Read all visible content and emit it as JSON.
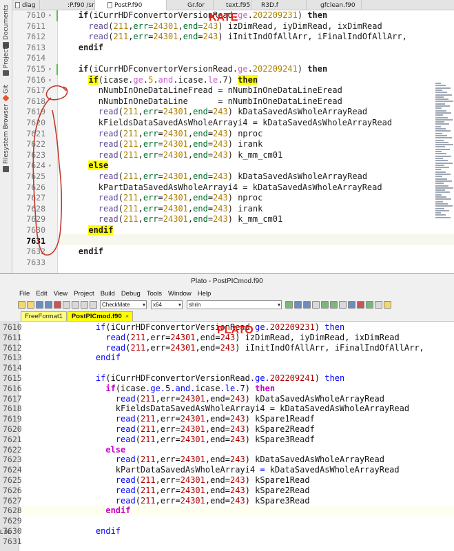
{
  "kate": {
    "annotation": "KATE",
    "side_panels": [
      "Documents",
      "Projects",
      "Git",
      "Filesystem Browser"
    ],
    "tabs": [
      "diag",
      ":P.f90 /src/io",
      "PostP.f90",
      "Gr.for",
      "text.f95",
      "R3D.f",
      "gfclean.f90"
    ],
    "active_tab": 2,
    "lines": [
      {
        "n": "7610",
        "fold": "▾",
        "code": "    if(iCurrHDFconvertorVersionRead.ge.202209231) then"
      },
      {
        "n": "7611",
        "fold": "",
        "code": "      read(211,err=24301,end=243) izDimRead, iyDimRead, ixDimRead"
      },
      {
        "n": "7612",
        "fold": "",
        "code": "      read(211,err=24301,end=243) iInitIndOfAllArr, iFinalIndOfAllArr,"
      },
      {
        "n": "7613",
        "fold": "",
        "code": "    endif"
      },
      {
        "n": "7614",
        "fold": "",
        "code": ""
      },
      {
        "n": "7615",
        "fold": "▾",
        "code": "    if(iCurrHDFconvertorVersionRead.ge.202209241) then"
      },
      {
        "n": "7616",
        "fold": "▾",
        "code": "      if(icase.ge.5.and.icase.le.7) then"
      },
      {
        "n": "7617",
        "fold": "",
        "code": "        nNumbInOneDataLineFread = nNumbInOneDataLineEread"
      },
      {
        "n": "7618",
        "fold": "",
        "code": "        nNumbInOneDataLine      = nNumbInOneDataLineEread"
      },
      {
        "n": "7619",
        "fold": "",
        "code": "        read(211,err=24301,end=243) kDataSavedAsWholeArrayRead"
      },
      {
        "n": "7620",
        "fold": "",
        "code": "        kFieldsDataSavedAsWholeArrayi4 = kDataSavedAsWholeArrayRead"
      },
      {
        "n": "7621",
        "fold": "",
        "code": "        read(211,err=24301,end=243) nproc"
      },
      {
        "n": "7622",
        "fold": "",
        "code": "        read(211,err=24301,end=243) irank"
      },
      {
        "n": "7623",
        "fold": "",
        "code": "        read(211,err=24301,end=243) k_mm_cm01"
      },
      {
        "n": "7624",
        "fold": "▾",
        "code": "      else"
      },
      {
        "n": "7625",
        "fold": "",
        "code": "        read(211,err=24301,end=243) kDataSavedAsWholeArrayRead"
      },
      {
        "n": "7626",
        "fold": "",
        "code": "        kPartDataSavedAsWholeArrayi4 = kDataSavedAsWholeArrayRead"
      },
      {
        "n": "7627",
        "fold": "",
        "code": "        read(211,err=24301,end=243) nproc"
      },
      {
        "n": "7628",
        "fold": "",
        "code": "        read(211,err=24301,end=243) irank"
      },
      {
        "n": "7629",
        "fold": "",
        "code": "        read(211,err=24301,end=243) k_mm_cm01"
      },
      {
        "n": "7630",
        "fold": "",
        "code": "      endif"
      },
      {
        "n": "7631",
        "fold": "",
        "code": ""
      },
      {
        "n": "7632",
        "fold": "",
        "code": "    endif"
      },
      {
        "n": "7633",
        "fold": "",
        "code": ""
      }
    ],
    "current_line": "7631"
  },
  "plato": {
    "window_title": "Plato - PostPICmod.f90",
    "annotation": "PLATO",
    "menu": [
      "File",
      "Edit",
      "View",
      "Project",
      "Build",
      "Debug",
      "Tools",
      "Window",
      "Help"
    ],
    "toolbar": {
      "config": "CheckMate",
      "platform": "x64",
      "search": "shrin"
    },
    "tabs": [
      "FreeFormat1",
      "PostPICmod.f90"
    ],
    "tab_close": "×",
    "left_label": "L  90",
    "lines": [
      {
        "n": "7610",
        "code": "    if(iCurrHDFconvertorVersionRead.ge.202209231) then"
      },
      {
        "n": "7611",
        "code": "      read(211,err=24301,end=243) izDimRead, iyDimRead, ixDimRead"
      },
      {
        "n": "7612",
        "code": "      read(211,err=24301,end=243) iInitIndOfAllArr, iFinalIndOfAllArr,"
      },
      {
        "n": "7613",
        "code": "    endif"
      },
      {
        "n": "7614",
        "code": ""
      },
      {
        "n": "7615",
        "code": "    if(iCurrHDFconvertorVersionRead.ge.202209241) then"
      },
      {
        "n": "7616",
        "code": "      if(icase.ge.5.and.icase.le.7) then"
      },
      {
        "n": "7617",
        "code": "        read(211,err=24301,end=243) kDataSavedAsWholeArrayRead"
      },
      {
        "n": "7618",
        "code": "        kFieldsDataSavedAsWholeArrayi4 = kDataSavedAsWholeArrayRead"
      },
      {
        "n": "7619",
        "code": "        read(211,err=24301,end=243) kSpare1Readf"
      },
      {
        "n": "7620",
        "code": "        read(211,err=24301,end=243) kSpare2Readf"
      },
      {
        "n": "7621",
        "code": "        read(211,err=24301,end=243) kSpare3Readf"
      },
      {
        "n": "7622",
        "code": "      else"
      },
      {
        "n": "7623",
        "code": "        read(211,err=24301,end=243) kDataSavedAsWholeArrayRead"
      },
      {
        "n": "7624",
        "code": "        kPartDataSavedAsWholeArrayi4 = kDataSavedAsWholeArrayRead"
      },
      {
        "n": "7625",
        "code": "        read(211,err=24301,end=243) kSpare1Read"
      },
      {
        "n": "7626",
        "code": "        read(211,err=24301,end=243) kSpare2Read"
      },
      {
        "n": "7627",
        "code": "        read(211,err=24301,end=243) kSpare3Read"
      },
      {
        "n": "7628",
        "code": "      endif"
      },
      {
        "n": "7629",
        "code": ""
      },
      {
        "n": "7630",
        "code": "    endif"
      },
      {
        "n": "7631",
        "code": ""
      }
    ],
    "current_line": "7628"
  },
  "colors": {
    "annotation": "#e2231a",
    "kate_highlight": "#ffff00",
    "plato_keyword": "#0000ff",
    "plato_keyword2": "#c800c8",
    "plato_number": "#b00000"
  }
}
